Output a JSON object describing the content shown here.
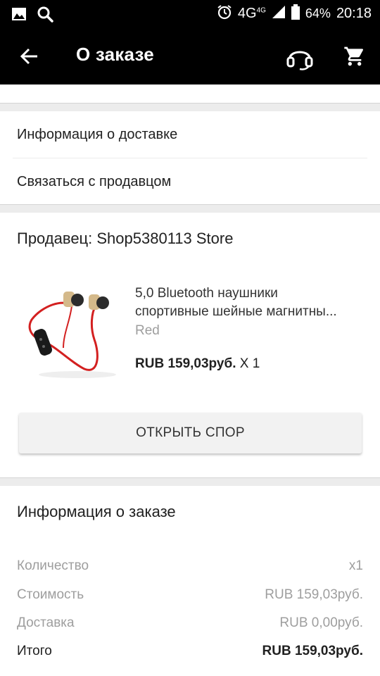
{
  "status_bar": {
    "network": "4G",
    "network_small": "4G",
    "battery": "64%",
    "time": "20:18"
  },
  "app_bar": {
    "title": "О заказе"
  },
  "links": {
    "delivery_info": "Информация о доставке",
    "contact_seller": "Связаться с продавцом"
  },
  "seller": {
    "label": "Продавец: Shop5380113 Store"
  },
  "product": {
    "title_line1": "5,0 Bluetooth наушники",
    "title_line2": "спортивные шейные магнитны...",
    "variant": "Red",
    "price": "RUB 159,03руб.",
    "quantity": "X 1"
  },
  "dispute_button": "ОТКРЫТЬ СПОР",
  "order_info": {
    "title": "Информация о заказе",
    "rows": [
      {
        "label": "Количество",
        "value": "x1"
      },
      {
        "label": "Стоимость",
        "value": "RUB 159,03руб."
      },
      {
        "label": "Доставка",
        "value": "RUB 0,00руб."
      }
    ],
    "total": {
      "label": "Итого",
      "value": "RUB 159,03руб."
    }
  }
}
